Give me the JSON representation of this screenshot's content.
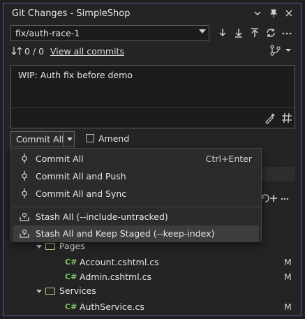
{
  "window": {
    "title": "Git Changes - SimpleShop"
  },
  "toolbar": {
    "branch": "fix/auth-race-1",
    "sync_counts": "0 / 0",
    "view_all_commits": "View all commits"
  },
  "commit_message": {
    "value": "WIP: Auth fix before demo"
  },
  "commit": {
    "button_label": "Commit All",
    "amend_label": "Amend"
  },
  "commit_menu": {
    "items": [
      {
        "label": "Commit All",
        "shortcut": "Ctrl+Enter"
      },
      {
        "label": "Commit All and Push",
        "shortcut": ""
      },
      {
        "label": "Commit All and Sync",
        "shortcut": ""
      },
      {
        "label": "Stash All (--include-untracked)",
        "shortcut": ""
      },
      {
        "label": "Stash All and Keep Staged (--keep-index)",
        "shortcut": ""
      }
    ]
  },
  "tree": {
    "folders": [
      {
        "name": "Pages",
        "files": [
          {
            "lang": "C#",
            "name": "Account.cshtml.cs",
            "status": "M"
          },
          {
            "lang": "C#",
            "name": "Admin.cshtml.cs",
            "status": "M"
          }
        ]
      },
      {
        "name": "Services",
        "files": [
          {
            "lang": "C#",
            "name": "AuthService.cs",
            "status": "M"
          }
        ]
      }
    ]
  },
  "colors": {
    "accent_border": "#6a4fb0",
    "csharp_icon": "#7ac36a",
    "folder_icon": "#d8c27a"
  }
}
